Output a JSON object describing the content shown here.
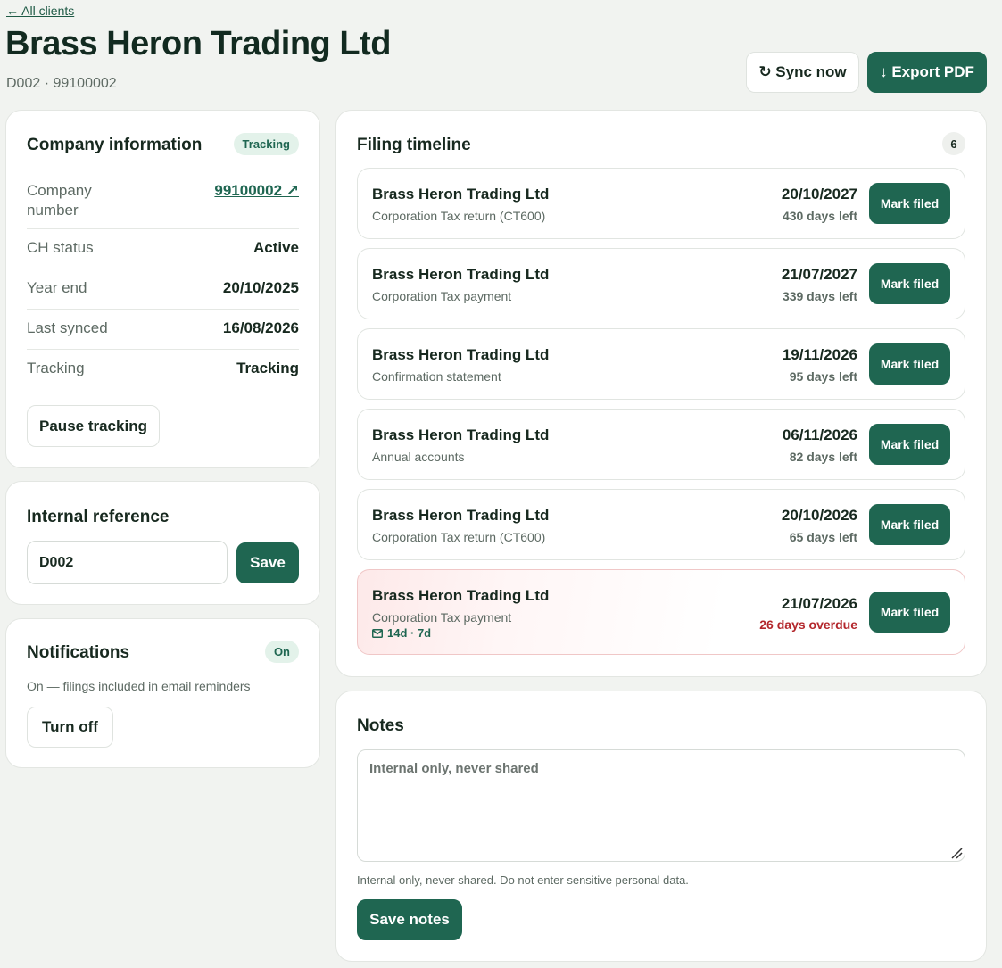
{
  "header": {
    "back_link": "← All clients",
    "title": "Brass Heron Trading Ltd",
    "subtitle": "D002 · 99100002",
    "sync_label": "↻ Sync now",
    "export_label": "↓ Export PDF"
  },
  "company_info": {
    "title": "Company information",
    "badge": "Tracking",
    "rows": [
      {
        "label": "Company number",
        "value": "99100002 ↗"
      },
      {
        "label": "CH status",
        "value": "Active"
      },
      {
        "label": "Year end",
        "value": "20/10/2025"
      },
      {
        "label": "Last synced",
        "value": "16/08/2026"
      },
      {
        "label": "Tracking",
        "value": "Tracking"
      }
    ],
    "pause_label": "Pause tracking"
  },
  "internal_reference": {
    "title": "Internal reference",
    "value": "D002",
    "save_label": "Save"
  },
  "notifications": {
    "title": "Notifications",
    "badge": "On",
    "description": "On — filings included in email reminders",
    "toggle_label": "Turn off"
  },
  "timeline": {
    "title": "Filing timeline",
    "count": "6",
    "items": [
      {
        "company": "Brass Heron Trading Ltd",
        "type": "Corporation Tax return (CT600)",
        "date": "20/10/2027",
        "remaining": "430 days left",
        "action": "Mark filed"
      },
      {
        "company": "Brass Heron Trading Ltd",
        "type": "Corporation Tax payment",
        "date": "21/07/2027",
        "remaining": "339 days left",
        "action": "Mark filed"
      },
      {
        "company": "Brass Heron Trading Ltd",
        "type": "Confirmation statement",
        "date": "19/11/2026",
        "remaining": "95 days left",
        "action": "Mark filed"
      },
      {
        "company": "Brass Heron Trading Ltd",
        "type": "Annual accounts",
        "date": "06/11/2026",
        "remaining": "82 days left",
        "action": "Mark filed"
      },
      {
        "company": "Brass Heron Trading Ltd",
        "type": "Corporation Tax return (CT600)",
        "date": "20/10/2026",
        "remaining": "65 days left",
        "action": "Mark filed"
      },
      {
        "company": "Brass Heron Trading Ltd",
        "type": "Corporation Tax payment",
        "reminder": "14d · 7d",
        "date": "21/07/2026",
        "remaining": "26 days overdue",
        "action": "Mark filed"
      }
    ]
  },
  "notes": {
    "title": "Notes",
    "placeholder": "Internal only, never shared",
    "hint": "Internal only, never shared. Do not enter sensitive personal data.",
    "save_label": "Save notes"
  },
  "colors": {
    "primary": "#1f6651",
    "overdue": "#b3262b",
    "background": "#f1f3f0"
  }
}
